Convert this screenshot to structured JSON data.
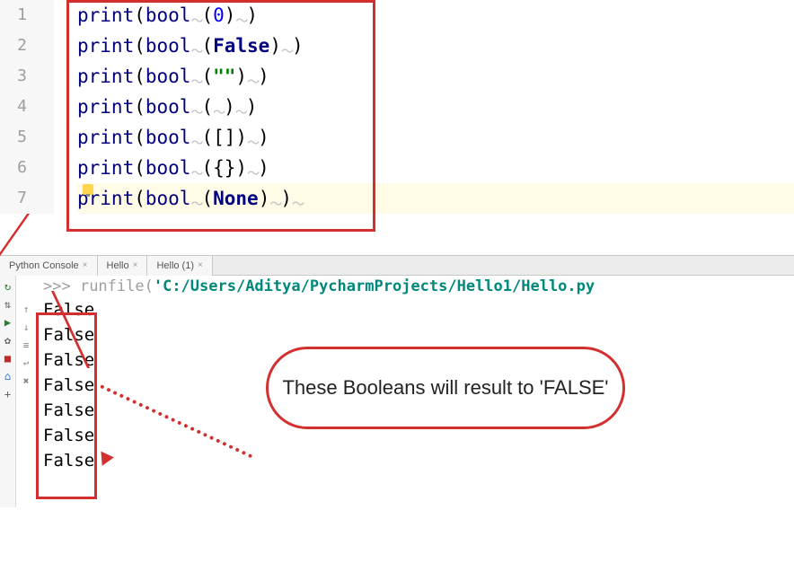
{
  "editor": {
    "lines": [
      {
        "num": "1",
        "pre": "print",
        "inner": "bool",
        "arg_type": "num",
        "arg": "0",
        "hl": false
      },
      {
        "num": "2",
        "pre": "print",
        "inner": "bool",
        "arg_type": "const",
        "arg": "False",
        "hl": false
      },
      {
        "num": "3",
        "pre": "print",
        "inner": "bool",
        "arg_type": "str",
        "arg": "\"\"",
        "hl": false
      },
      {
        "num": "4",
        "pre": "print",
        "inner": "bool",
        "arg_type": "empty",
        "arg": " ",
        "hl": false
      },
      {
        "num": "5",
        "pre": "print",
        "inner": "bool",
        "arg_type": "plain",
        "arg": "[]",
        "hl": false
      },
      {
        "num": "6",
        "pre": "print",
        "inner": "bool",
        "arg_type": "plain",
        "arg": "{}",
        "hl": false
      },
      {
        "num": "7",
        "pre": "print",
        "inner": "bool",
        "arg_type": "const",
        "arg": "None",
        "hl": true
      }
    ]
  },
  "tabs": {
    "items": [
      {
        "label": "Python Console"
      },
      {
        "label": "Hello"
      },
      {
        "label": "Hello (1)"
      }
    ]
  },
  "console": {
    "prompt_prefix": ">>> ",
    "prompt_cmd_a": "runfile(",
    "prompt_cmd_b": "'C:/Users/Aditya/PycharmProjects/Hello1/Hello.py",
    "output": [
      "False",
      "False",
      "False",
      "False",
      "False",
      "False",
      "False"
    ]
  },
  "callout": {
    "text": "These Booleans will result to 'FALSE'"
  },
  "tool_icons": {
    "rerun": "↻",
    "align": "⇅",
    "play": "▶",
    "gear": "✿",
    "stop": "■",
    "debug": "⌂",
    "add": "+"
  },
  "run_icons": {
    "up": "↑",
    "down": "↓",
    "filter": "≡",
    "wrap": "↩",
    "del": "✖"
  }
}
